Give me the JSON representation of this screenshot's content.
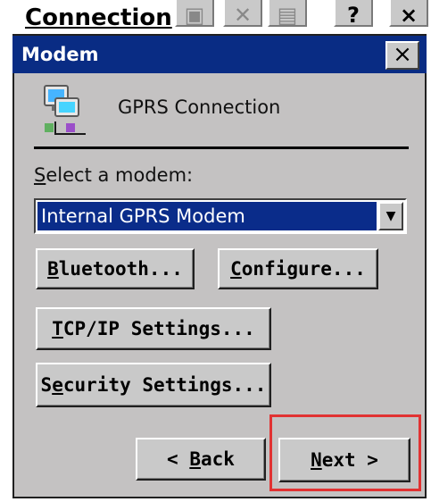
{
  "parent_window": {
    "title": "Connection",
    "toolbar": {
      "icons": [
        "disk-icon",
        "cut-icon",
        "properties-icon"
      ],
      "help_label": "?",
      "close_label": "×"
    }
  },
  "dialog": {
    "title": "Modem",
    "close_label": "×",
    "connection_name": "GPRS Connection",
    "select_label": "Select a modem:",
    "selected_modem": "Internal GPRS Modem",
    "buttons": {
      "bluetooth": "Bluetooth...",
      "configure": "Configure...",
      "tcpip": "TCP/IP Settings...",
      "security": "Security Settings...",
      "back": "< Back",
      "next": "Next >"
    }
  },
  "colors": {
    "titlebar": "#092c84",
    "dialog_bg": "#c4c2c2",
    "highlight": "#e13232",
    "selection": "#0a2c8a"
  }
}
